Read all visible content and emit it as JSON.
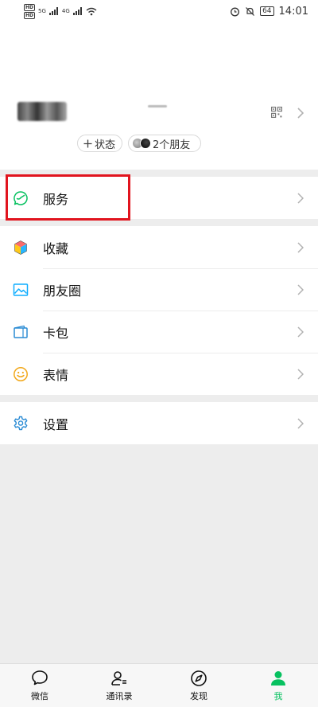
{
  "status_bar": {
    "left_badges": [
      "HD",
      "HD"
    ],
    "signal1": "5G",
    "signal2": "4G",
    "battery": "64",
    "time": "14:01"
  },
  "profile": {
    "status_chip": "状态",
    "friends_chip": "2个朋友"
  },
  "menu": {
    "services": "服务",
    "favorites": "收藏",
    "moments": "朋友圈",
    "cards": "卡包",
    "stickers": "表情",
    "settings": "设置"
  },
  "nav": {
    "chats": "微信",
    "contacts": "通讯录",
    "discover": "发现",
    "me": "我"
  },
  "colors": {
    "accent": "#07c160",
    "highlight": "#e1141e"
  }
}
